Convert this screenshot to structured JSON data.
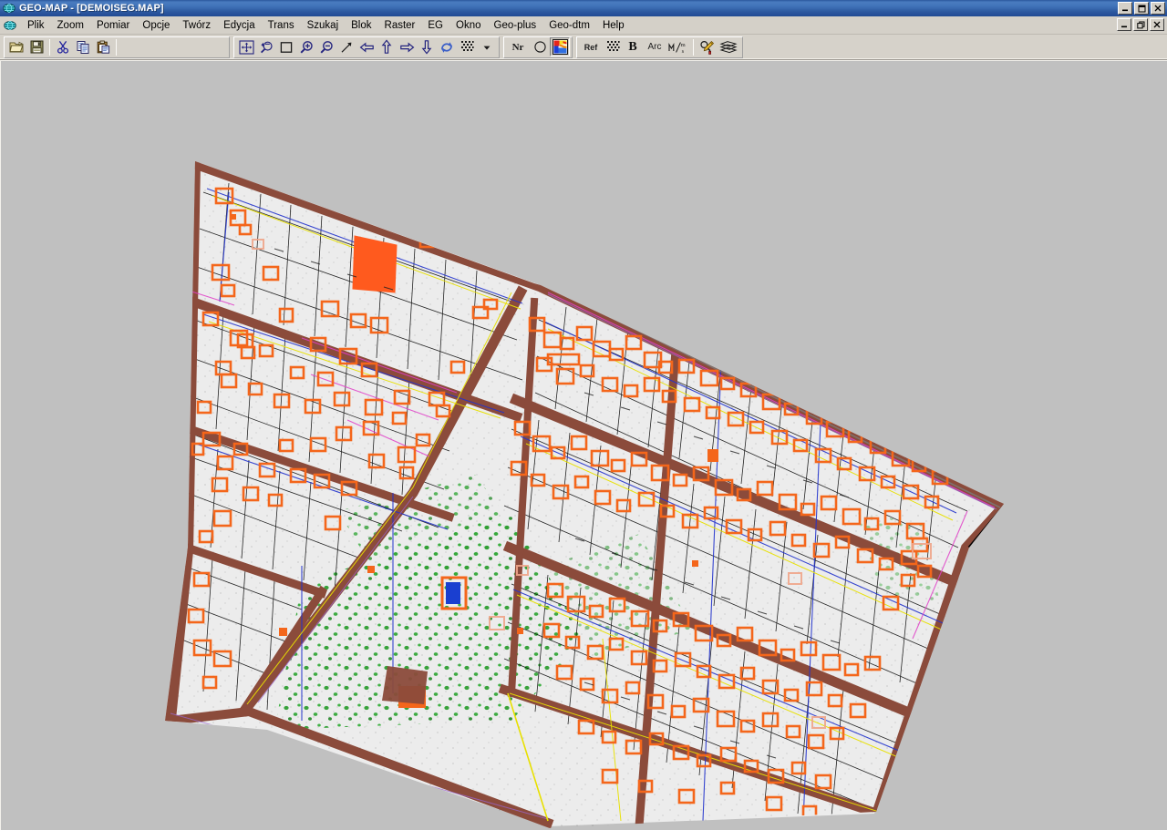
{
  "window": {
    "title": "GEO-MAP - [DEMOISEG.MAP]",
    "app_icon": "globe-icon",
    "controls": {
      "minimize": "_",
      "maximize": "□",
      "close": "✕"
    },
    "mdi_controls": {
      "minimize": "_",
      "restore": "❐",
      "close": "✕"
    }
  },
  "menu": {
    "icon": "globe-icon",
    "items": [
      {
        "label": "Plik"
      },
      {
        "label": "Zoom"
      },
      {
        "label": "Pomiar"
      },
      {
        "label": "Opcje"
      },
      {
        "label": "Twórz"
      },
      {
        "label": "Edycja"
      },
      {
        "label": "Trans"
      },
      {
        "label": "Szukaj"
      },
      {
        "label": "Blok"
      },
      {
        "label": "Raster"
      },
      {
        "label": "EG"
      },
      {
        "label": "Okno"
      },
      {
        "label": "Geo-plus"
      },
      {
        "label": "Geo-dtm"
      },
      {
        "label": "Help"
      }
    ]
  },
  "toolbar": {
    "group_file": [
      {
        "name": "open-icon",
        "tooltip": "Open"
      },
      {
        "name": "save-icon",
        "tooltip": "Save"
      },
      {
        "name": "cut-icon",
        "tooltip": "Cut"
      },
      {
        "name": "copy-icon",
        "tooltip": "Copy"
      },
      {
        "name": "paste-icon",
        "tooltip": "Paste"
      }
    ],
    "group_view": [
      {
        "name": "zoom-extents-icon",
        "tooltip": "Zoom extents"
      },
      {
        "name": "zoom-previous-icon",
        "tooltip": "Zoom previous"
      },
      {
        "name": "zoom-window-icon",
        "tooltip": "Zoom window"
      },
      {
        "name": "zoom-in-icon",
        "tooltip": "Zoom in"
      },
      {
        "name": "zoom-out-icon",
        "tooltip": "Zoom out"
      },
      {
        "name": "arrow-diagonal-icon",
        "tooltip": "Pan diagonal"
      },
      {
        "name": "pan-left-icon",
        "tooltip": "Pan left"
      },
      {
        "name": "pan-up-icon",
        "tooltip": "Pan up"
      },
      {
        "name": "pan-right-icon",
        "tooltip": "Pan right"
      },
      {
        "name": "pan-down-icon",
        "tooltip": "Pan down"
      },
      {
        "name": "refresh-icon",
        "tooltip": "Redraw"
      },
      {
        "name": "hatch-icon",
        "tooltip": "Hatch pattern"
      },
      {
        "name": "dropdown-arrow-icon",
        "tooltip": "More"
      }
    ],
    "group_draw": [
      {
        "name": "number-label",
        "label": "Nr"
      },
      {
        "name": "circle-icon",
        "tooltip": "Circle"
      },
      {
        "name": "palette-icon",
        "tooltip": "Colors",
        "active": true
      }
    ],
    "group_tools": [
      {
        "name": "ref-button",
        "label": "Ref"
      },
      {
        "name": "hatch2-icon",
        "tooltip": "Hatch"
      },
      {
        "name": "bold-button",
        "label": "B"
      },
      {
        "name": "arc-button",
        "label": "Arc"
      },
      {
        "name": "units-ms-icon",
        "label": "m/s"
      },
      {
        "name": "pen-tools-icon",
        "tooltip": "Draw tools"
      },
      {
        "name": "layers-icon",
        "tooltip": "Layers"
      }
    ]
  },
  "map": {
    "name": "cadastral-map-canvas",
    "background_color": "#c0c0c0",
    "sheet_color": "#ececec",
    "road_color": "#8b4b3b",
    "building_color": "#f4661b",
    "boundary_color": "#000000",
    "vegetation_color": "#2f9e33",
    "highlight_parcel_color": "#ff5a1e",
    "selected_building_color": "#1a3fd0",
    "utility_blue": "#2233cc",
    "utility_yellow": "#e8e000",
    "utility_magenta": "#e040c8",
    "parcel_line_color": "#000000"
  }
}
